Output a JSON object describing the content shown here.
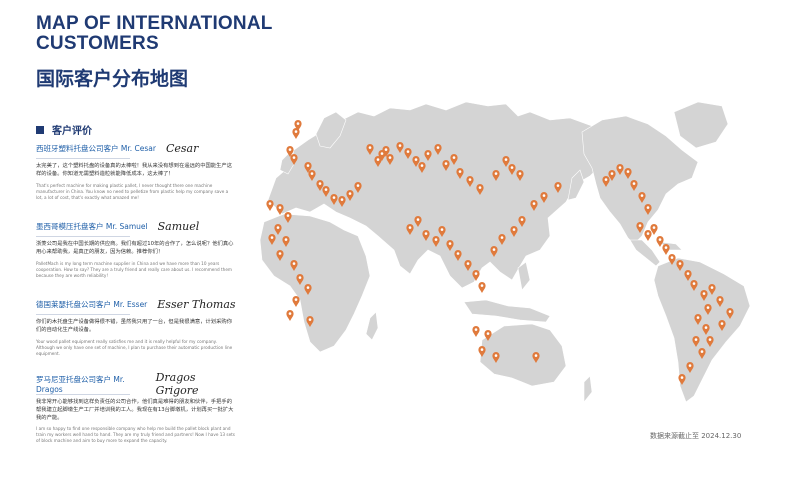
{
  "header": {
    "title_en": "MAP OF INTERNATIONAL CUSTOMERS",
    "title_cn": "国际客户分布地图"
  },
  "reviews_section": {
    "label": "客户评价"
  },
  "reviews": [
    {
      "name": "西班牙塑料托盘公司客户 Mr. Cesar",
      "signature": "Cesar",
      "cn": "太完美了，这个塑料托盘的设备真的太棒啦！我从来没有想到在遥远的中国能生产这样的设备。你知道无需塑料造粒就能降低成本，这太棒了！",
      "en": "That's perfect machine for making plastic pallet, I never thought there one machine manufacturer in China. You know no need to pelletize from plastic help my company save a lot, a lot of cost, that's exactly what amazed me!"
    },
    {
      "name": "墨西哥模压托盘客户 Mr. Samuel",
      "signature": "Samuel",
      "cn": "浙菱公司是我在中国长期的供应商。我们有超过10年的合作了，怎么说呢？他们真心用心来帮助我，是真正的朋友，因为信赖。推荐你们！",
      "en": "PalletMach is my long term machine supplier in China and we have more than 10 years cooperation. How to say? They are a truly friend and really care about us. I recommend them because they are worth reliability!"
    },
    {
      "name": "德国莱瑟托盘公司客户 Mr. Esser",
      "signature": "Esser Thomas",
      "cn": "你们的木托盘生产设备做得很不错，虽然我只用了一台，但是我很满意，计划采购你们的自动化生产线设备。",
      "en": "Your wood pallet equipment really satisfies me and it is really helpful for my company. Although we only have one set of machine, I plan to purchase their automatic production line equipment."
    },
    {
      "name": "罗马尼亚托盘公司客户 Mr. Dragos",
      "signature": "Dragos Grigore",
      "cn": "我非常开心能够找到这样负责任的公司合作，他们真是难得的朋友和伙伴，手把手的帮我建立起脚墩生产工厂并培训我的工人。我现在有13台脚墩机，计划再买一批扩大我的产能。",
      "en": "I am so happy to find one responsible company who help me build the pallet block plant and train my workers well hand to hand. They are my truly friend and partners! Now I have 13 sets of block machine and aim to buy more to expand the capacity."
    }
  ],
  "map": {
    "land_color": "#d4d4d4",
    "pin_color": "#e07a3c",
    "pin_icon": "map-pin-icon"
  },
  "footer": {
    "data_note": "数据来源截止至 2024.12.30"
  }
}
